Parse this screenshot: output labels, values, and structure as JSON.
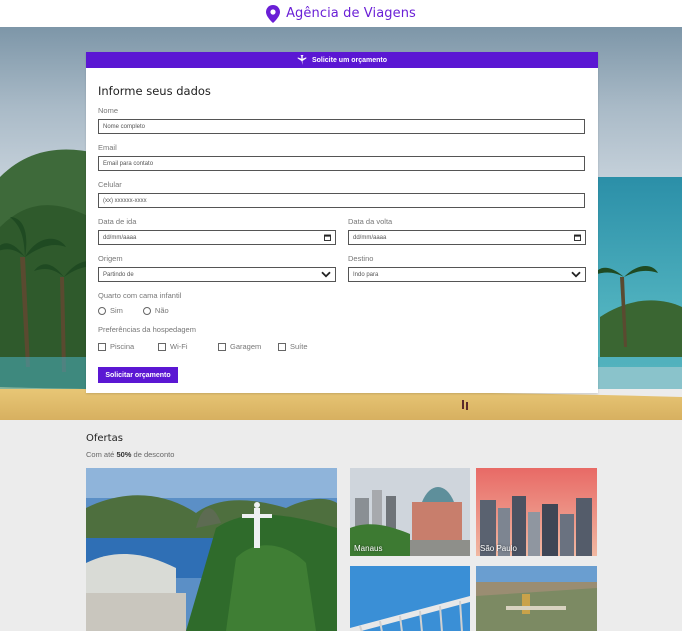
{
  "header": {
    "brand": "Agência de Viagens",
    "brand_color": "#6a1fd6",
    "icon": "map-pin-icon"
  },
  "form": {
    "banner": "Solicite um orçamento",
    "banner_icon": "airplane-icon",
    "title": "Informe seus dados",
    "name_label": "Nome",
    "name_placeholder": "Nome completo",
    "email_label": "Email",
    "email_placeholder": "Email para contato",
    "phone_label": "Celular",
    "phone_placeholder": "(xx) xxxxxx-xxxx",
    "depart_label": "Data de ida",
    "depart_value": "dd/mm/aaaa",
    "return_label": "Data da volta",
    "return_value": "dd/mm/aaaa",
    "origin_label": "Origem",
    "origin_value": "Partindo de",
    "destination_label": "Destino",
    "destination_value": "Indo para",
    "crib_label": "Quarto com cama infantil",
    "crib_options": [
      "Sim",
      "Não"
    ],
    "prefs_label": "Preferências da hospedagem",
    "prefs_options": [
      "Piscina",
      "Wi-Fi",
      "Garagem",
      "Suíte"
    ],
    "submit_label": "Solicitar orçamento",
    "accent": "#5b17d3"
  },
  "offers": {
    "title": "Ofertas",
    "subtitle_prefix": "Com até ",
    "subtitle_bold": "50%",
    "subtitle_suffix": " de desconto",
    "tiles": [
      {
        "caption": ""
      },
      {
        "caption": "Manaus"
      },
      {
        "caption": "São Paulo"
      },
      {
        "caption": ""
      },
      {
        "caption": ""
      }
    ]
  }
}
